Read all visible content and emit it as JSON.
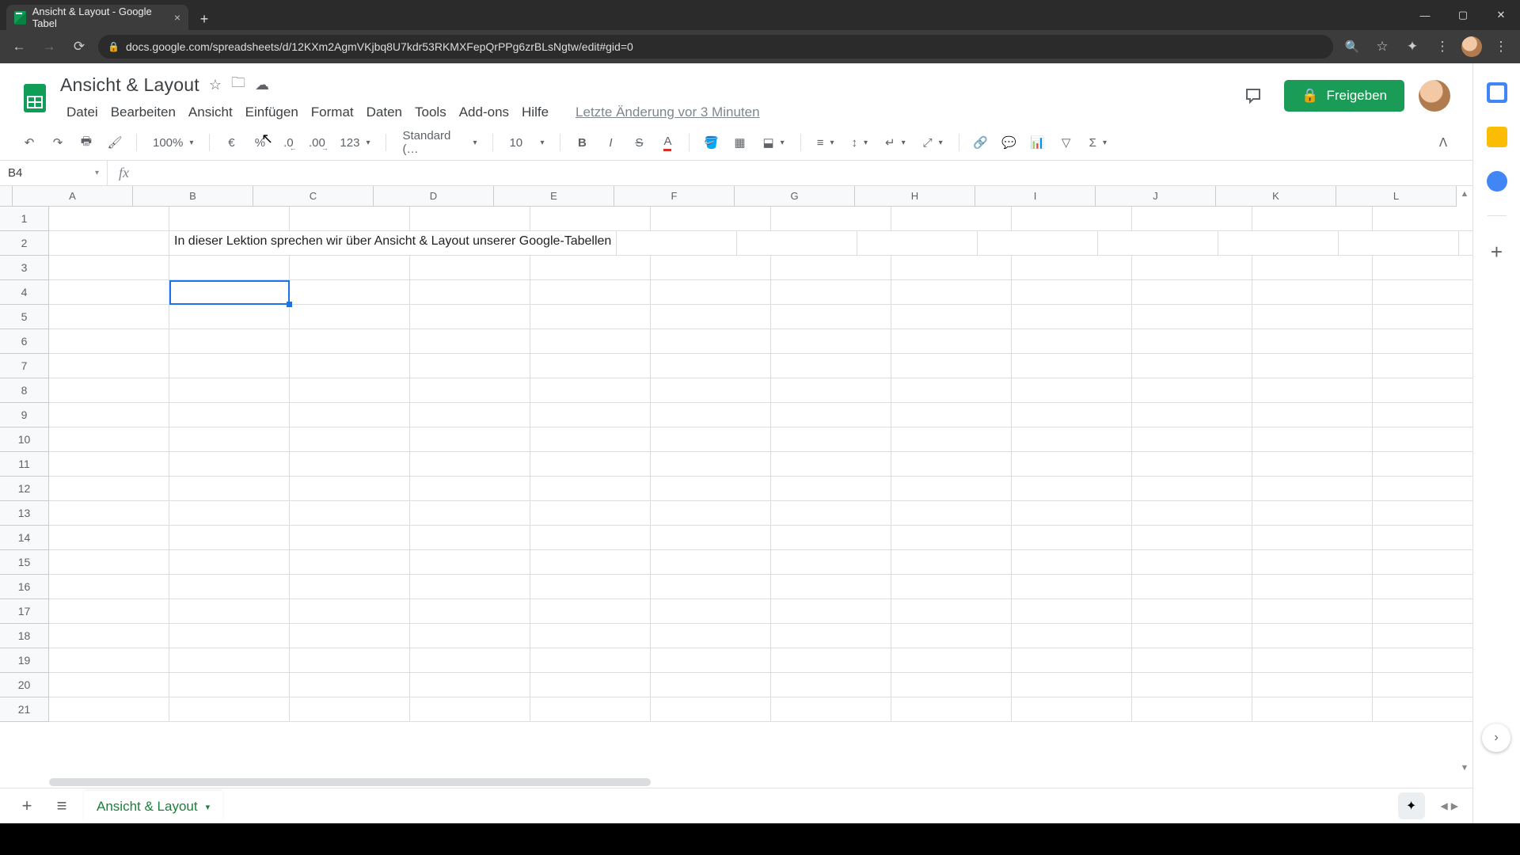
{
  "browser": {
    "tab_title": "Ansicht & Layout - Google Tabel",
    "url": "docs.google.com/spreadsheets/d/12KXm2AgmVKjbq8U7kdr53RKMXFepQrPPg6zrBLsNgtw/edit#gid=0"
  },
  "doc": {
    "title": "Ansicht & Layout",
    "last_edit": "Letzte Änderung vor 3 Minuten",
    "share_label": "Freigeben"
  },
  "menus": [
    "Datei",
    "Bearbeiten",
    "Ansicht",
    "Einfügen",
    "Format",
    "Daten",
    "Tools",
    "Add-ons",
    "Hilfe"
  ],
  "toolbar": {
    "zoom": "100%",
    "currency": "€",
    "percent": "%",
    "dec_dec": ".0",
    "inc_dec": ".00",
    "more_formats": "123",
    "font": "Standard (…",
    "font_size": "10"
  },
  "name_box": "B4",
  "fx_value": "",
  "columns": [
    "A",
    "B",
    "C",
    "D",
    "E",
    "F",
    "G",
    "H",
    "I",
    "J",
    "K",
    "L"
  ],
  "rows": [
    1,
    2,
    3,
    4,
    5,
    6,
    7,
    8,
    9,
    10,
    11,
    12,
    13,
    14,
    15,
    16,
    17,
    18,
    19,
    20,
    21
  ],
  "cells": {
    "B2": "In dieser Lektion sprechen wir über Ansicht & Layout unserer Google-Tabellen"
  },
  "active_cell": "B4",
  "sheet_tab": "Ansicht & Layout"
}
